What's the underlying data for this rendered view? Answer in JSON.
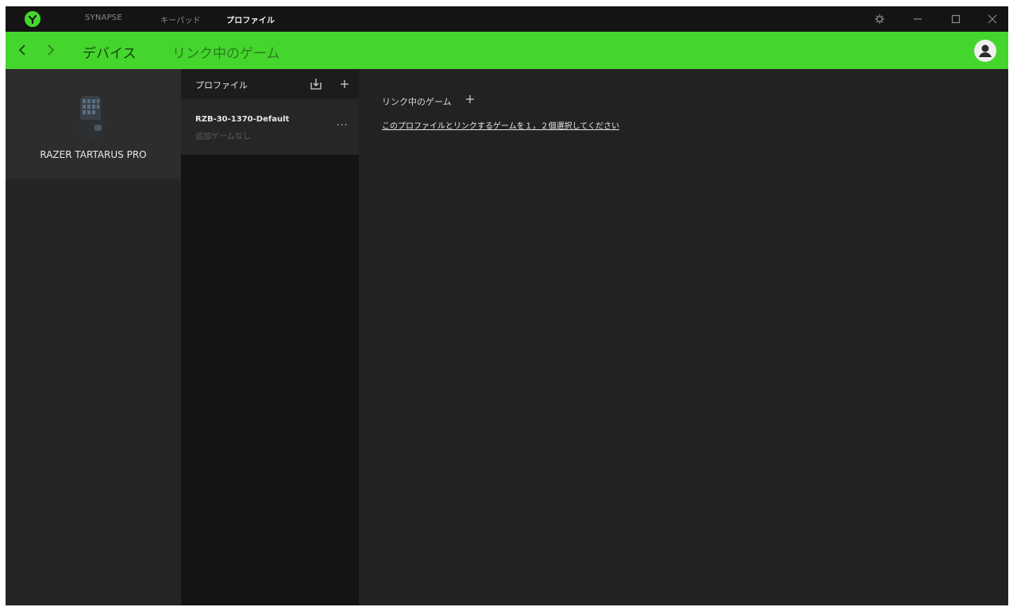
{
  "titlebar": {
    "tabs": [
      {
        "label": "SYNAPSE",
        "active": false
      },
      {
        "label": "キーパッド",
        "active": false
      },
      {
        "label": "プロファイル",
        "active": true
      }
    ],
    "icons": [
      "settings-icon",
      "minimize-icon",
      "maximize-icon",
      "close-icon"
    ]
  },
  "subnav": {
    "tabs": [
      {
        "label": "デバイス"
      },
      {
        "label": "リンク中のゲーム"
      }
    ]
  },
  "device": {
    "name": "RAZER TARTARUS PRO"
  },
  "profiles": {
    "header": "プロファイル",
    "items": [
      {
        "name": "RZB-30-1370-Default",
        "subtitle": "追加ゲームなし",
        "more": "..."
      }
    ]
  },
  "linked_games": {
    "title": "リンク中のゲーム",
    "link": "このプロファイルとリンクするゲームを１，２個選択してください"
  },
  "colors": {
    "accent": "#44d62c",
    "background": "#222222",
    "titlebar": "#141414"
  }
}
